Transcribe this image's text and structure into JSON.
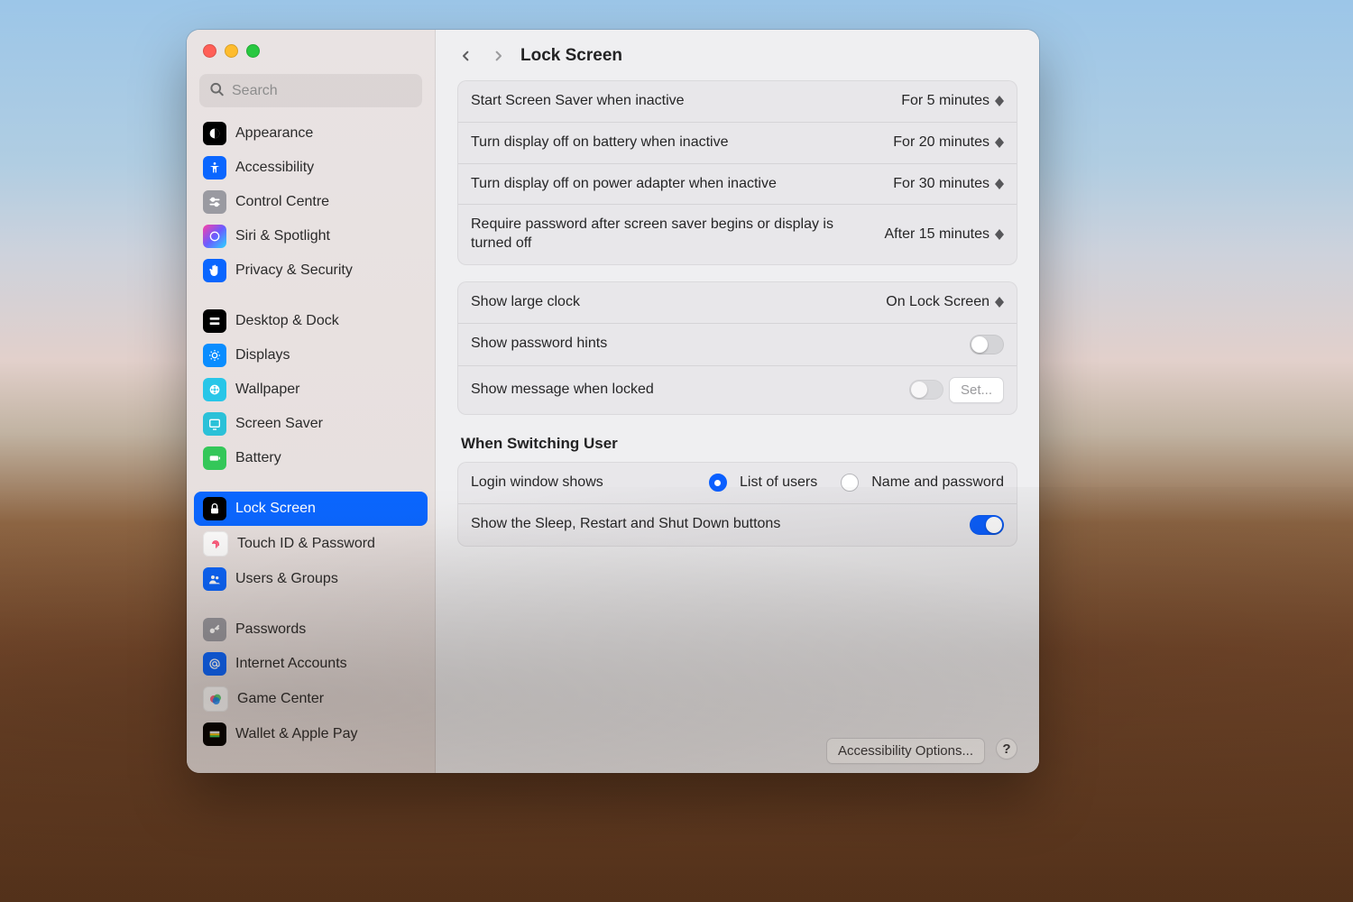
{
  "search": {
    "placeholder": "Search"
  },
  "sidebar": {
    "items": [
      {
        "label": "Appearance"
      },
      {
        "label": "Accessibility"
      },
      {
        "label": "Control Centre"
      },
      {
        "label": "Siri & Spotlight"
      },
      {
        "label": "Privacy & Security"
      },
      {
        "label": "Desktop & Dock"
      },
      {
        "label": "Displays"
      },
      {
        "label": "Wallpaper"
      },
      {
        "label": "Screen Saver"
      },
      {
        "label": "Battery"
      },
      {
        "label": "Lock Screen"
      },
      {
        "label": "Touch ID & Password"
      },
      {
        "label": "Users & Groups"
      },
      {
        "label": "Passwords"
      },
      {
        "label": "Internet Accounts"
      },
      {
        "label": "Game Center"
      },
      {
        "label": "Wallet & Apple Pay"
      }
    ]
  },
  "header": {
    "title": "Lock Screen"
  },
  "group1": {
    "screensaver": {
      "label": "Start Screen Saver when inactive",
      "value": "For 5 minutes"
    },
    "displayBattery": {
      "label": "Turn display off on battery when inactive",
      "value": "For 20 minutes"
    },
    "displayAdapter": {
      "label": "Turn display off on power adapter when inactive",
      "value": "For 30 minutes"
    },
    "requirePassword": {
      "label": "Require password after screen saver begins or display is turned off",
      "value": "After 15 minutes"
    }
  },
  "group2": {
    "largeClock": {
      "label": "Show large clock",
      "value": "On Lock Screen"
    },
    "passwordHints": {
      "label": "Show password hints",
      "on": false
    },
    "lockMessage": {
      "label": "Show message when locked",
      "on": false,
      "button": "Set..."
    }
  },
  "switching": {
    "heading": "When Switching User",
    "loginShows": {
      "label": "Login window shows",
      "opt1": "List of users",
      "opt2": "Name and password",
      "selected": 1
    },
    "sleepButtons": {
      "label": "Show the Sleep, Restart and Shut Down buttons",
      "on": true
    }
  },
  "footer": {
    "accessibility": "Accessibility Options...",
    "help": "?"
  }
}
